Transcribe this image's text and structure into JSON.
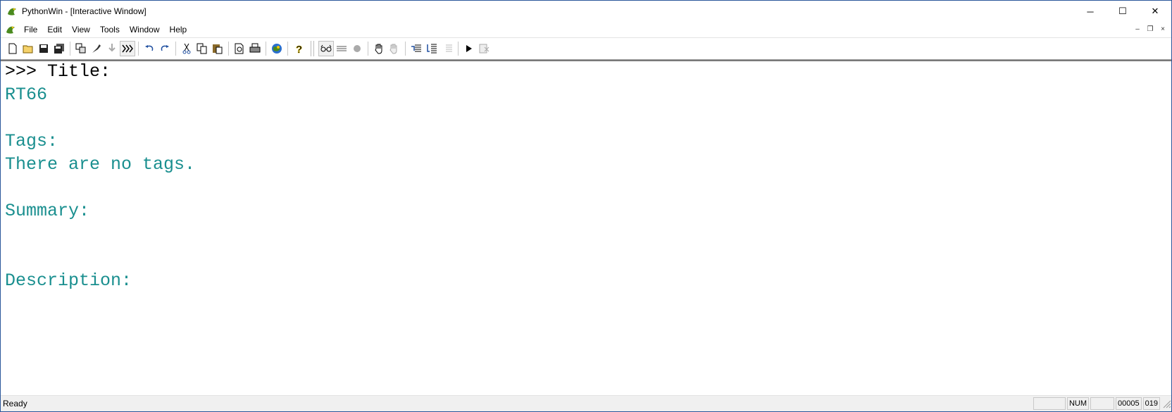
{
  "window": {
    "title": "PythonWin - [Interactive Window]",
    "minimize_glyph": "─",
    "maximize_glyph": "☐",
    "close_glyph": "✕"
  },
  "menu": {
    "items": [
      "File",
      "Edit",
      "View",
      "Tools",
      "Window",
      "Help"
    ],
    "mdi_minimize": "–",
    "mdi_restore": "❐",
    "mdi_close": "×"
  },
  "toolbar": {
    "icons": [
      "new-file-icon",
      "open-folder-icon",
      "save-icon",
      "save-all-icon",
      "locate-icon",
      "run-icon",
      "import-icon",
      "interactive-icon",
      "undo-icon",
      "redo-icon",
      "cut-icon",
      "copy-icon",
      "paste-icon",
      "print-preview-icon",
      "print-icon",
      "browser-icon",
      "help-icon",
      "watch-icon",
      "stack-icon",
      "breakpoint-icon",
      "go-icon",
      "step-icon",
      "step-over-icon",
      "step-out-icon",
      "close-debugger-icon"
    ]
  },
  "console": {
    "prompt": ">>> ",
    "lines": [
      {
        "prompt": true,
        "text": "Title:"
      },
      {
        "text": "RT66"
      },
      {
        "text": ""
      },
      {
        "text": "Tags:"
      },
      {
        "text": "There are no tags."
      },
      {
        "text": ""
      },
      {
        "text": "Summary:"
      },
      {
        "text": ""
      },
      {
        "text": ""
      },
      {
        "text": "Description:"
      }
    ]
  },
  "status": {
    "text": "Ready",
    "num": "NUM",
    "line": "00005",
    "col": "019"
  },
  "colors": {
    "output_text": "#1a8f8f",
    "prompt_text": "#000000",
    "titlebar_border": "#2b579a"
  }
}
